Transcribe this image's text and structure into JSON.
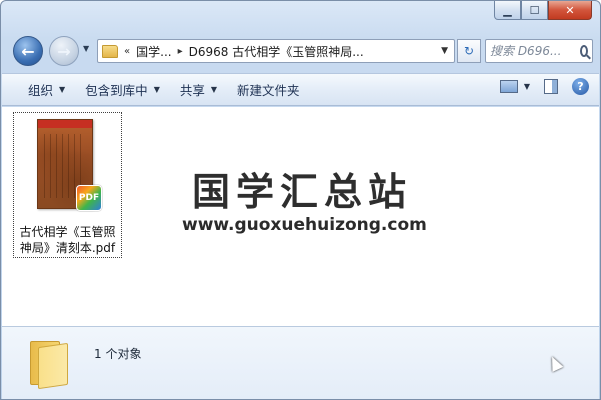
{
  "window": {
    "caption_buttons": {
      "minimize": "▁",
      "maximize": "☐",
      "close": "✕"
    }
  },
  "nav": {
    "back_glyph": "←",
    "forward_glyph": "→",
    "history_drop": "▼"
  },
  "address": {
    "chevrons": "«",
    "crumb_1": "国学...",
    "separator": "▸",
    "crumb_2": "D6968 古代相学《玉管照神局...",
    "dropdown": "▼"
  },
  "refresh_glyph": "↻",
  "search": {
    "placeholder": "搜索 D696..."
  },
  "toolbar": {
    "organize": "组织",
    "include_in_library": "包含到库中",
    "share": "共享",
    "new_folder": "新建文件夹",
    "drop_arrow": "▼",
    "help_glyph": "?"
  },
  "file": {
    "badge": "PDF",
    "name": "古代相学《玉管照神局》清刻本.pdf"
  },
  "watermark": {
    "title": "国学汇总站",
    "url": "www.guoxuehuizong.com"
  },
  "details": {
    "count": "1 个对象"
  }
}
